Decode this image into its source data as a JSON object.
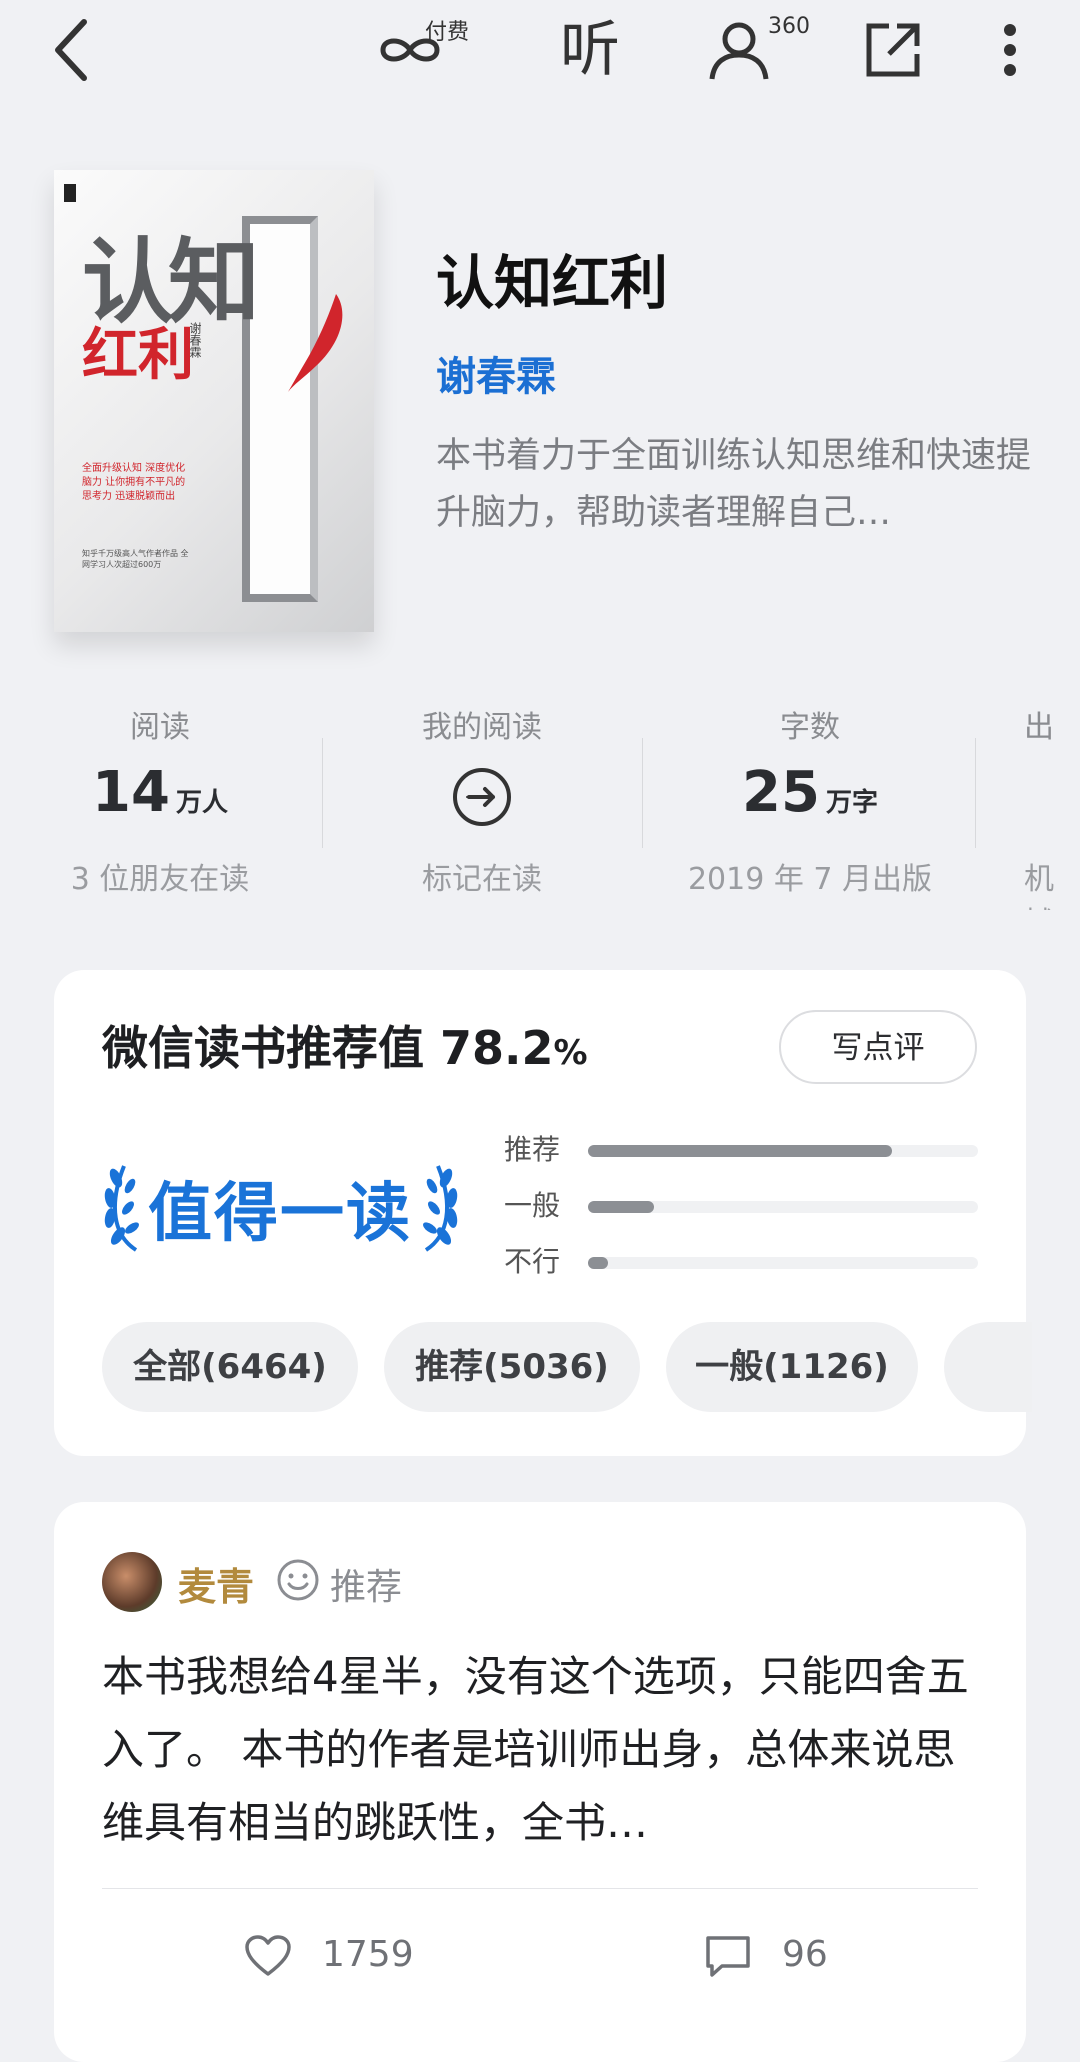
{
  "topbar": {
    "pay_label": "付费",
    "listen_label": "听",
    "friends_count": "360"
  },
  "book": {
    "title": "认知红利",
    "author": "谢春霖",
    "description": "本书着力于全面训练认知思维和快速提升脑力，帮助读者理解自己…",
    "cover": {
      "title_line1": "认知",
      "title_line2": "红利",
      "author_vertical": "谢春霖",
      "tagline_red": "全面升级认知 深度优化脑力 让你拥有不平凡的思考力 迅速脱颖而出",
      "tagline_gray": "知乎千万级高人气作者作品 全网学习人次超过600万"
    }
  },
  "stats": [
    {
      "label": "阅读",
      "value": "14",
      "unit": "万人",
      "sub": "3 位朋友在读"
    },
    {
      "label": "我的阅读",
      "icon": "arrow-circle-icon",
      "sub": "标记在读"
    },
    {
      "label": "字数",
      "value": "25",
      "unit": "万字",
      "sub": "2019 年 7 月出版"
    },
    {
      "label": "出",
      "sub": "机械"
    }
  ],
  "rating": {
    "title": "微信读书推荐值",
    "score": "78.2",
    "percent_sign": "%",
    "write_review_label": "写点评",
    "badge_text": "值得一读",
    "bars": [
      {
        "label": "推荐",
        "fraction": 0.78
      },
      {
        "label": "一般",
        "fraction": 0.17
      },
      {
        "label": "不行",
        "fraction": 0.05
      }
    ],
    "filters": [
      {
        "label": "全部(6464)"
      },
      {
        "label": "推荐(5036)"
      },
      {
        "label": "一般(1126)"
      }
    ]
  },
  "review": {
    "user": "麦青",
    "tag": "推荐",
    "text": "本书我想给4星半，没有这个选项，只能四舍五入了。 本书的作者是培训师出身，总体来说思维具有相当的跳跃性，全书…",
    "likes": "1759",
    "comments": "96"
  },
  "colors": {
    "background": "#f0f1f4",
    "accent_blue": "#1a73d8",
    "author_blue": "#1b6fd3",
    "reviewer_gold": "#b28a3d",
    "bar_gray": "#8c8f94"
  }
}
